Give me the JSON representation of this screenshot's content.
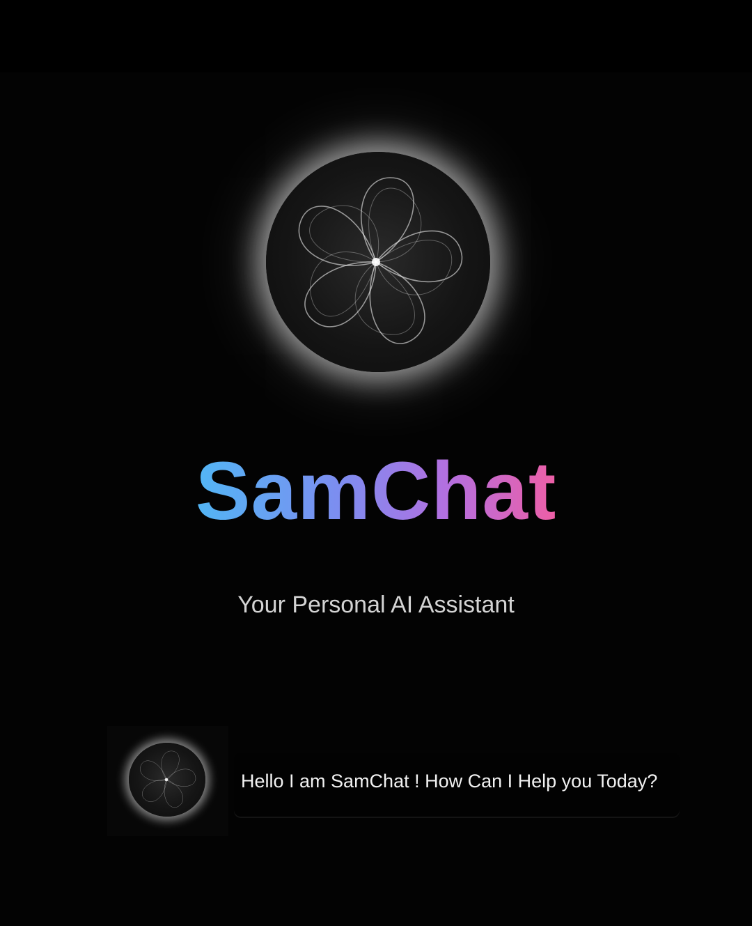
{
  "app": {
    "title": "SamChat",
    "subtitle": "Your Personal AI Assistant"
  },
  "chat": {
    "message": "Hello I am SamChat ! How Can I Help you Today?"
  },
  "icons": {
    "hero": "flower-orb-logo",
    "avatar": "flower-orb-avatar"
  },
  "colors": {
    "background": "#000000",
    "title_gradient": [
      "#52b6f5",
      "#7d8df0",
      "#b46fe0",
      "#ee5fa6"
    ],
    "subtitle": "#d4d4d4",
    "message_text": "#f2f2f2"
  }
}
